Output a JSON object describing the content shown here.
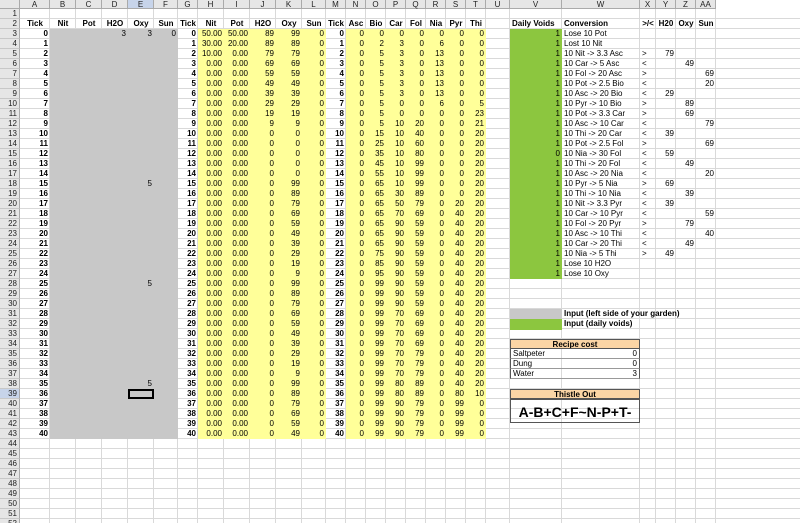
{
  "columns": [
    "A",
    "B",
    "C",
    "D",
    "E",
    "F",
    "G",
    "H",
    "I",
    "J",
    "K",
    "L",
    "M",
    "N",
    "O",
    "P",
    "Q",
    "R",
    "S",
    "T",
    "U",
    "V",
    "W",
    "X",
    "Y",
    "Z",
    "AA"
  ],
  "selected_column": "E",
  "selected_row": 39,
  "headers_row2": {
    "A": "Tick",
    "B": "Nit",
    "C": "Pot",
    "D": "H2O",
    "E": "Oxy",
    "F": "Sun",
    "G": "Tick",
    "H": "Nit",
    "I": "Pot",
    "J": "H2O",
    "K": "Oxy",
    "L": "Sun",
    "M": "Tick",
    "N": "Asc",
    "O": "Bio",
    "P": "Car",
    "Q": "Fol",
    "R": "Nia",
    "S": "Pyr",
    "T": "Thi",
    "V": "Daily Voids",
    "W": "Conversion",
    "X": ">/<",
    "Y": "H20",
    "Z": "Oxy",
    "AA": "Sun"
  },
  "left_inputs": [
    {
      "row": 3,
      "D": "3",
      "E": "3",
      "F": "0"
    },
    {
      "row": 18,
      "E": "5"
    },
    {
      "row": 28,
      "E": "5"
    },
    {
      "row": 38,
      "E": "5"
    }
  ],
  "sim_rows": [
    {
      "t": 0,
      "nit": "50.00",
      "pot": "50.00",
      "h2o": "89",
      "oxy": "99",
      "sun": "0"
    },
    {
      "t": 1,
      "nit": "30.00",
      "pot": "20.00",
      "h2o": "89",
      "oxy": "89",
      "sun": "0"
    },
    {
      "t": 2,
      "nit": "10.00",
      "pot": "0.00",
      "h2o": "79",
      "oxy": "79",
      "sun": "0"
    },
    {
      "t": 3,
      "nit": "0.00",
      "pot": "0.00",
      "h2o": "69",
      "oxy": "69",
      "sun": "0"
    },
    {
      "t": 4,
      "nit": "0.00",
      "pot": "0.00",
      "h2o": "59",
      "oxy": "59",
      "sun": "0"
    },
    {
      "t": 5,
      "nit": "0.00",
      "pot": "0.00",
      "h2o": "49",
      "oxy": "49",
      "sun": "0"
    },
    {
      "t": 6,
      "nit": "0.00",
      "pot": "0.00",
      "h2o": "39",
      "oxy": "39",
      "sun": "0"
    },
    {
      "t": 7,
      "nit": "0.00",
      "pot": "0.00",
      "h2o": "29",
      "oxy": "29",
      "sun": "0"
    },
    {
      "t": 8,
      "nit": "0.00",
      "pot": "0.00",
      "h2o": "19",
      "oxy": "19",
      "sun": "0"
    },
    {
      "t": 9,
      "nit": "0.00",
      "pot": "0.00",
      "h2o": "9",
      "oxy": "9",
      "sun": "0"
    },
    {
      "t": 10,
      "nit": "0.00",
      "pot": "0.00",
      "h2o": "0",
      "oxy": "0",
      "sun": "0"
    },
    {
      "t": 11,
      "nit": "0.00",
      "pot": "0.00",
      "h2o": "0",
      "oxy": "0",
      "sun": "0"
    },
    {
      "t": 12,
      "nit": "0.00",
      "pot": "0.00",
      "h2o": "0",
      "oxy": "0",
      "sun": "0"
    },
    {
      "t": 13,
      "nit": "0.00",
      "pot": "0.00",
      "h2o": "0",
      "oxy": "0",
      "sun": "0"
    },
    {
      "t": 14,
      "nit": "0.00",
      "pot": "0.00",
      "h2o": "0",
      "oxy": "0",
      "sun": "0"
    },
    {
      "t": 15,
      "nit": "0.00",
      "pot": "0.00",
      "h2o": "0",
      "oxy": "99",
      "sun": "0"
    },
    {
      "t": 16,
      "nit": "0.00",
      "pot": "0.00",
      "h2o": "0",
      "oxy": "89",
      "sun": "0"
    },
    {
      "t": 17,
      "nit": "0.00",
      "pot": "0.00",
      "h2o": "0",
      "oxy": "79",
      "sun": "0"
    },
    {
      "t": 18,
      "nit": "0.00",
      "pot": "0.00",
      "h2o": "0",
      "oxy": "69",
      "sun": "0"
    },
    {
      "t": 19,
      "nit": "0.00",
      "pot": "0.00",
      "h2o": "0",
      "oxy": "59",
      "sun": "0"
    },
    {
      "t": 20,
      "nit": "0.00",
      "pot": "0.00",
      "h2o": "0",
      "oxy": "49",
      "sun": "0"
    },
    {
      "t": 21,
      "nit": "0.00",
      "pot": "0.00",
      "h2o": "0",
      "oxy": "39",
      "sun": "0"
    },
    {
      "t": 22,
      "nit": "0.00",
      "pot": "0.00",
      "h2o": "0",
      "oxy": "29",
      "sun": "0"
    },
    {
      "t": 23,
      "nit": "0.00",
      "pot": "0.00",
      "h2o": "0",
      "oxy": "19",
      "sun": "0"
    },
    {
      "t": 24,
      "nit": "0.00",
      "pot": "0.00",
      "h2o": "0",
      "oxy": "9",
      "sun": "0"
    },
    {
      "t": 25,
      "nit": "0.00",
      "pot": "0.00",
      "h2o": "0",
      "oxy": "99",
      "sun": "0"
    },
    {
      "t": 26,
      "nit": "0.00",
      "pot": "0.00",
      "h2o": "0",
      "oxy": "89",
      "sun": "0"
    },
    {
      "t": 27,
      "nit": "0.00",
      "pot": "0.00",
      "h2o": "0",
      "oxy": "79",
      "sun": "0"
    },
    {
      "t": 28,
      "nit": "0.00",
      "pot": "0.00",
      "h2o": "0",
      "oxy": "69",
      "sun": "0"
    },
    {
      "t": 29,
      "nit": "0.00",
      "pot": "0.00",
      "h2o": "0",
      "oxy": "59",
      "sun": "0"
    },
    {
      "t": 30,
      "nit": "0.00",
      "pot": "0.00",
      "h2o": "0",
      "oxy": "49",
      "sun": "0"
    },
    {
      "t": 31,
      "nit": "0.00",
      "pot": "0.00",
      "h2o": "0",
      "oxy": "39",
      "sun": "0"
    },
    {
      "t": 32,
      "nit": "0.00",
      "pot": "0.00",
      "h2o": "0",
      "oxy": "29",
      "sun": "0"
    },
    {
      "t": 33,
      "nit": "0.00",
      "pot": "0.00",
      "h2o": "0",
      "oxy": "19",
      "sun": "0"
    },
    {
      "t": 34,
      "nit": "0.00",
      "pot": "0.00",
      "h2o": "0",
      "oxy": "9",
      "sun": "0"
    },
    {
      "t": 35,
      "nit": "0.00",
      "pot": "0.00",
      "h2o": "0",
      "oxy": "99",
      "sun": "0"
    },
    {
      "t": 36,
      "nit": "0.00",
      "pot": "0.00",
      "h2o": "0",
      "oxy": "89",
      "sun": "0"
    },
    {
      "t": 37,
      "nit": "0.00",
      "pot": "0.00",
      "h2o": "0",
      "oxy": "79",
      "sun": "0"
    },
    {
      "t": 38,
      "nit": "0.00",
      "pot": "0.00",
      "h2o": "0",
      "oxy": "69",
      "sun": "0"
    },
    {
      "t": 39,
      "nit": "0.00",
      "pot": "0.00",
      "h2o": "0",
      "oxy": "59",
      "sun": "0"
    },
    {
      "t": 40,
      "nit": "0.00",
      "pot": "0.00",
      "h2o": "0",
      "oxy": "49",
      "sun": "0"
    }
  ],
  "chem_rows": [
    {
      "t": 0,
      "v": [
        "0",
        "0",
        "0",
        "0",
        "0",
        "0",
        "0"
      ]
    },
    {
      "t": 1,
      "v": [
        "0",
        "2",
        "3",
        "0",
        "6",
        "0",
        "0"
      ]
    },
    {
      "t": 2,
      "v": [
        "0",
        "5",
        "3",
        "0",
        "13",
        "0",
        "0"
      ]
    },
    {
      "t": 3,
      "v": [
        "0",
        "5",
        "3",
        "0",
        "13",
        "0",
        "0"
      ]
    },
    {
      "t": 4,
      "v": [
        "0",
        "5",
        "3",
        "0",
        "13",
        "0",
        "0"
      ]
    },
    {
      "t": 5,
      "v": [
        "0",
        "5",
        "3",
        "0",
        "13",
        "0",
        "0"
      ]
    },
    {
      "t": 6,
      "v": [
        "0",
        "5",
        "3",
        "0",
        "13",
        "0",
        "0"
      ]
    },
    {
      "t": 7,
      "v": [
        "0",
        "5",
        "0",
        "0",
        "6",
        "0",
        "5"
      ]
    },
    {
      "t": 8,
      "v": [
        "0",
        "5",
        "0",
        "0",
        "0",
        "0",
        "23"
      ]
    },
    {
      "t": 9,
      "v": [
        "0",
        "5",
        "10",
        "20",
        "0",
        "0",
        "21"
      ]
    },
    {
      "t": 10,
      "v": [
        "0",
        "15",
        "10",
        "40",
        "0",
        "0",
        "20"
      ]
    },
    {
      "t": 11,
      "v": [
        "0",
        "25",
        "10",
        "60",
        "0",
        "0",
        "20"
      ]
    },
    {
      "t": 12,
      "v": [
        "0",
        "35",
        "10",
        "80",
        "0",
        "0",
        "20"
      ]
    },
    {
      "t": 13,
      "v": [
        "0",
        "45",
        "10",
        "99",
        "0",
        "0",
        "20"
      ]
    },
    {
      "t": 14,
      "v": [
        "0",
        "55",
        "10",
        "99",
        "0",
        "0",
        "20"
      ]
    },
    {
      "t": 15,
      "v": [
        "0",
        "65",
        "10",
        "99",
        "0",
        "0",
        "20"
      ]
    },
    {
      "t": 16,
      "v": [
        "0",
        "65",
        "30",
        "89",
        "0",
        "0",
        "20"
      ]
    },
    {
      "t": 17,
      "v": [
        "0",
        "65",
        "50",
        "79",
        "0",
        "20",
        "20"
      ]
    },
    {
      "t": 18,
      "v": [
        "0",
        "65",
        "70",
        "69",
        "0",
        "40",
        "20"
      ]
    },
    {
      "t": 19,
      "v": [
        "0",
        "65",
        "90",
        "59",
        "0",
        "40",
        "20"
      ]
    },
    {
      "t": 20,
      "v": [
        "0",
        "65",
        "90",
        "59",
        "0",
        "40",
        "20"
      ]
    },
    {
      "t": 21,
      "v": [
        "0",
        "65",
        "90",
        "59",
        "0",
        "40",
        "20"
      ]
    },
    {
      "t": 22,
      "v": [
        "0",
        "75",
        "90",
        "59",
        "0",
        "40",
        "20"
      ]
    },
    {
      "t": 23,
      "v": [
        "0",
        "85",
        "90",
        "59",
        "0",
        "40",
        "20"
      ]
    },
    {
      "t": 24,
      "v": [
        "0",
        "95",
        "90",
        "59",
        "0",
        "40",
        "20"
      ]
    },
    {
      "t": 25,
      "v": [
        "0",
        "99",
        "90",
        "59",
        "0",
        "40",
        "20"
      ]
    },
    {
      "t": 26,
      "v": [
        "0",
        "99",
        "90",
        "59",
        "0",
        "40",
        "20"
      ]
    },
    {
      "t": 27,
      "v": [
        "0",
        "99",
        "90",
        "59",
        "0",
        "40",
        "20"
      ]
    },
    {
      "t": 28,
      "v": [
        "0",
        "99",
        "70",
        "69",
        "0",
        "40",
        "20"
      ]
    },
    {
      "t": 29,
      "v": [
        "0",
        "99",
        "70",
        "69",
        "0",
        "40",
        "20"
      ]
    },
    {
      "t": 30,
      "v": [
        "0",
        "99",
        "70",
        "69",
        "0",
        "40",
        "20"
      ]
    },
    {
      "t": 31,
      "v": [
        "0",
        "99",
        "70",
        "69",
        "0",
        "40",
        "20"
      ]
    },
    {
      "t": 32,
      "v": [
        "0",
        "99",
        "70",
        "79",
        "0",
        "40",
        "20"
      ]
    },
    {
      "t": 33,
      "v": [
        "0",
        "99",
        "70",
        "79",
        "0",
        "40",
        "20"
      ]
    },
    {
      "t": 34,
      "v": [
        "0",
        "99",
        "70",
        "79",
        "0",
        "40",
        "20"
      ]
    },
    {
      "t": 35,
      "v": [
        "0",
        "99",
        "80",
        "89",
        "0",
        "40",
        "20"
      ]
    },
    {
      "t": 36,
      "v": [
        "0",
        "99",
        "80",
        "89",
        "0",
        "80",
        "10"
      ]
    },
    {
      "t": 37,
      "v": [
        "0",
        "99",
        "90",
        "79",
        "0",
        "99",
        "0"
      ]
    },
    {
      "t": 38,
      "v": [
        "0",
        "99",
        "90",
        "79",
        "0",
        "99",
        "0"
      ]
    },
    {
      "t": 39,
      "v": [
        "0",
        "99",
        "90",
        "79",
        "0",
        "99",
        "0"
      ]
    },
    {
      "t": 40,
      "v": [
        "0",
        "99",
        "90",
        "79",
        "0",
        "99",
        "0"
      ]
    }
  ],
  "conversions": [
    {
      "void": "1",
      "text": "Lose 10 Pot",
      "cmp": "",
      "y": "",
      "z": "",
      "aa": ""
    },
    {
      "void": "1",
      "text": "Lost 10 Nit",
      "cmp": "",
      "y": "",
      "z": "",
      "aa": ""
    },
    {
      "void": "1",
      "text": "10 Nit -> 3.3 Asc",
      "cmp": ">",
      "y": "79",
      "z": "",
      "aa": ""
    },
    {
      "void": "1",
      "text": "10 Car -> 5 Asc",
      "cmp": "<",
      "y": "",
      "z": "49",
      "aa": ""
    },
    {
      "void": "1",
      "text": "10 Fol -> 20 Asc",
      "cmp": ">",
      "y": "",
      "z": "",
      "aa": "69"
    },
    {
      "void": "1",
      "text": "10 Pot -> 2.5 Bio",
      "cmp": "<",
      "y": "",
      "z": "",
      "aa": "20"
    },
    {
      "void": "1",
      "text": "10 Asc -> 20 Bio",
      "cmp": "<",
      "y": "29",
      "z": "",
      "aa": ""
    },
    {
      "void": "1",
      "text": "10 Pyr -> 10 Bio",
      "cmp": ">",
      "y": "",
      "z": "89",
      "aa": ""
    },
    {
      "void": "1",
      "text": "10 Pot -> 3.3 Car",
      "cmp": ">",
      "y": "",
      "z": "69",
      "aa": ""
    },
    {
      "void": "1",
      "text": "10 Asc -> 10 Car",
      "cmp": "<",
      "y": "",
      "z": "",
      "aa": "79"
    },
    {
      "void": "1",
      "text": "10 Thi -> 20 Car",
      "cmp": "<",
      "y": "39",
      "z": "",
      "aa": ""
    },
    {
      "void": "1",
      "text": "10 Pot -> 2.5 Fol",
      "cmp": ">",
      "y": "",
      "z": "",
      "aa": "69"
    },
    {
      "void": "0",
      "text": "10 Nia -> 30 Fol",
      "cmp": "<",
      "y": "59",
      "z": "",
      "aa": ""
    },
    {
      "void": "1",
      "text": "10 Thi -> 20 Fol",
      "cmp": "<",
      "y": "",
      "z": "49",
      "aa": ""
    },
    {
      "void": "1",
      "text": "10 Asc -> 20 Nia",
      "cmp": "<",
      "y": "",
      "z": "",
      "aa": "20"
    },
    {
      "void": "1",
      "text": "10 Pyr -> 5 Nia",
      "cmp": ">",
      "y": "69",
      "z": "",
      "aa": ""
    },
    {
      "void": "1",
      "text": "10 Thi -> 10 Nia",
      "cmp": "<",
      "y": "",
      "z": "39",
      "aa": ""
    },
    {
      "void": "1",
      "text": "10 Nit -> 3.3 Pyr",
      "cmp": "<",
      "y": "39",
      "z": "",
      "aa": ""
    },
    {
      "void": "1",
      "text": "10 Car -> 10 Pyr",
      "cmp": "<",
      "y": "",
      "z": "",
      "aa": "59"
    },
    {
      "void": "1",
      "text": "10 Fol -> 20 Pyr",
      "cmp": ">",
      "y": "",
      "z": "79",
      "aa": ""
    },
    {
      "void": "1",
      "text": "10 Asc -> 10 Thi",
      "cmp": "<",
      "y": "",
      "z": "",
      "aa": "40"
    },
    {
      "void": "1",
      "text": "10 Car -> 20 Thi",
      "cmp": "<",
      "y": "",
      "z": "49",
      "aa": ""
    },
    {
      "void": "1",
      "text": "10 Nia -> 5 Thi",
      "cmp": ">",
      "y": "49",
      "z": "",
      "aa": ""
    },
    {
      "void": "1",
      "text": "Lose 10 H2O",
      "cmp": "",
      "y": "",
      "z": "",
      "aa": ""
    },
    {
      "void": "1",
      "text": "Lose 10 Oxy",
      "cmp": "",
      "y": "",
      "z": "",
      "aa": ""
    }
  ],
  "legend": {
    "gray_label": "Input (left side of your garden)",
    "green_label": "Input (daily voids)"
  },
  "recipe": {
    "title": "Recipe cost",
    "items": [
      {
        "name": "Saltpeter",
        "value": "0"
      },
      {
        "name": "Dung",
        "value": "0"
      },
      {
        "name": "Water",
        "value": "3"
      }
    ]
  },
  "thistle": {
    "title": "Thistle Out",
    "formula": "A-B+C+F~N-P+T-"
  },
  "colors": {
    "gray": "#c8c8c8",
    "yellow": "#ffff99",
    "green": "#8cc63f",
    "orange": "#fbd5a5",
    "selected_header": "#c7d4ea"
  }
}
